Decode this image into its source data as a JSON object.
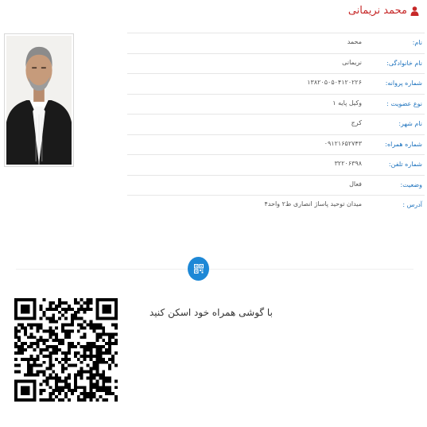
{
  "profile": {
    "title": "محمد نریمانی"
  },
  "fields": [
    {
      "label": "نام:",
      "value": "محمد"
    },
    {
      "label": "نام خانوادگی:",
      "value": "نریمانی"
    },
    {
      "label": "شماره پروانه:",
      "value": "۱۳۸۲۰۵۰۵۰۴۱۲۰۲۲۶"
    },
    {
      "label": "نوع عضویت :",
      "value": "وکیل پایه ۱"
    },
    {
      "label": "نام شهر:",
      "value": "کرج"
    },
    {
      "label": "شماره همراه:",
      "value": "۰۹۱۲۱۶۵۲۷۴۳"
    },
    {
      "label": "شماره تلفن:",
      "value": "۳۲۲۰۶۳۹۸"
    },
    {
      "label": "وضعیت:",
      "value": "فعال"
    },
    {
      "label": "آدرس :",
      "value": "میدان توحید پاساژ انصاری ط۲ واحد۴"
    }
  ],
  "qr_section": {
    "instruction": "با گوشی همراه خود اسکن کنید"
  },
  "colors": {
    "accent_red": "#c62828",
    "label_blue": "#1e73be",
    "badge_blue": "#1e88d6"
  },
  "icons": {
    "title": "user-icon",
    "badge": "qrcode-icon"
  }
}
